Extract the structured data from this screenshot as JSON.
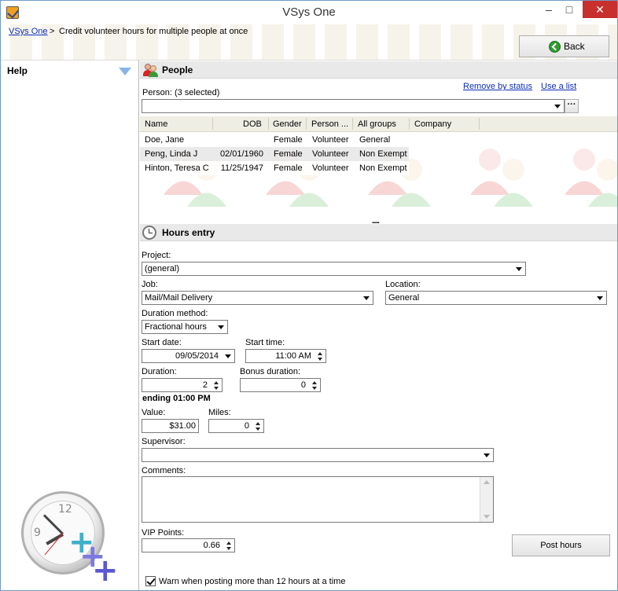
{
  "window": {
    "title": "VSys One",
    "min_glyph": "–",
    "max_glyph": "□",
    "close_glyph": "✕"
  },
  "breadcrumb": {
    "root": "VSys One",
    "separator": ">",
    "current": "Credit volunteer hours for multiple people at once"
  },
  "back_button": {
    "label": "Back"
  },
  "help": {
    "title": "Help",
    "clock_numbers": {
      "twelve": "12",
      "nine": "9"
    }
  },
  "people": {
    "title": "People",
    "remove_by_status": "Remove by status",
    "use_a_list": "Use a list",
    "person_label": "Person: (3 selected)",
    "person_value": "",
    "ellipsis": "···",
    "columns": [
      "Name",
      "DOB",
      "Gender",
      "Person ...",
      "All groups",
      "Company"
    ],
    "rows": [
      {
        "name": "Doe, Jane",
        "dob": "",
        "gender": "Female",
        "person": "Volunteer",
        "groups": "General",
        "company": ""
      },
      {
        "name": "Peng, Linda J",
        "dob": "02/01/1960",
        "gender": "Female",
        "person": "Volunteer",
        "groups": "Non Exempt",
        "company": ""
      },
      {
        "name": "Hinton, Teresa C",
        "dob": "11/25/1947",
        "gender": "Female",
        "person": "Volunteer",
        "groups": "Non Exempt",
        "company": ""
      }
    ],
    "resizer": "....."
  },
  "hours": {
    "title": "Hours entry",
    "project_label": "Project:",
    "project_value": "(general)",
    "job_label": "Job:",
    "job_value": "Mail/Mail Delivery",
    "location_label": "Location:",
    "location_value": "General",
    "duration_method_label": "Duration method:",
    "duration_method_value": "Fractional hours",
    "start_date_label": "Start date:",
    "start_date_value": "09/05/2014",
    "start_time_label": "Start time:",
    "start_time_value": "11:00 AM",
    "duration_label": "Duration:",
    "duration_value": "2",
    "bonus_duration_label": "Bonus duration:",
    "bonus_duration_value": "0",
    "ending_text": "ending 01:00 PM",
    "value_label": "Value:",
    "value_value": "$31.00",
    "miles_label": "Miles:",
    "miles_value": "0",
    "supervisor_label": "Supervisor:",
    "supervisor_value": "",
    "comments_label": "Comments:",
    "comments_value": "",
    "vip_points_label": "VIP Points:",
    "vip_points_value": "0.66",
    "post_hours_label": "Post hours",
    "warn_label": "Warn when posting more than 12 hours at a time",
    "warn_checked": true
  },
  "colors": {
    "link": "#0b2db6",
    "close_button": "#c7302c",
    "section_header": "#e9e9e9",
    "grid_header": "#efeee4"
  }
}
